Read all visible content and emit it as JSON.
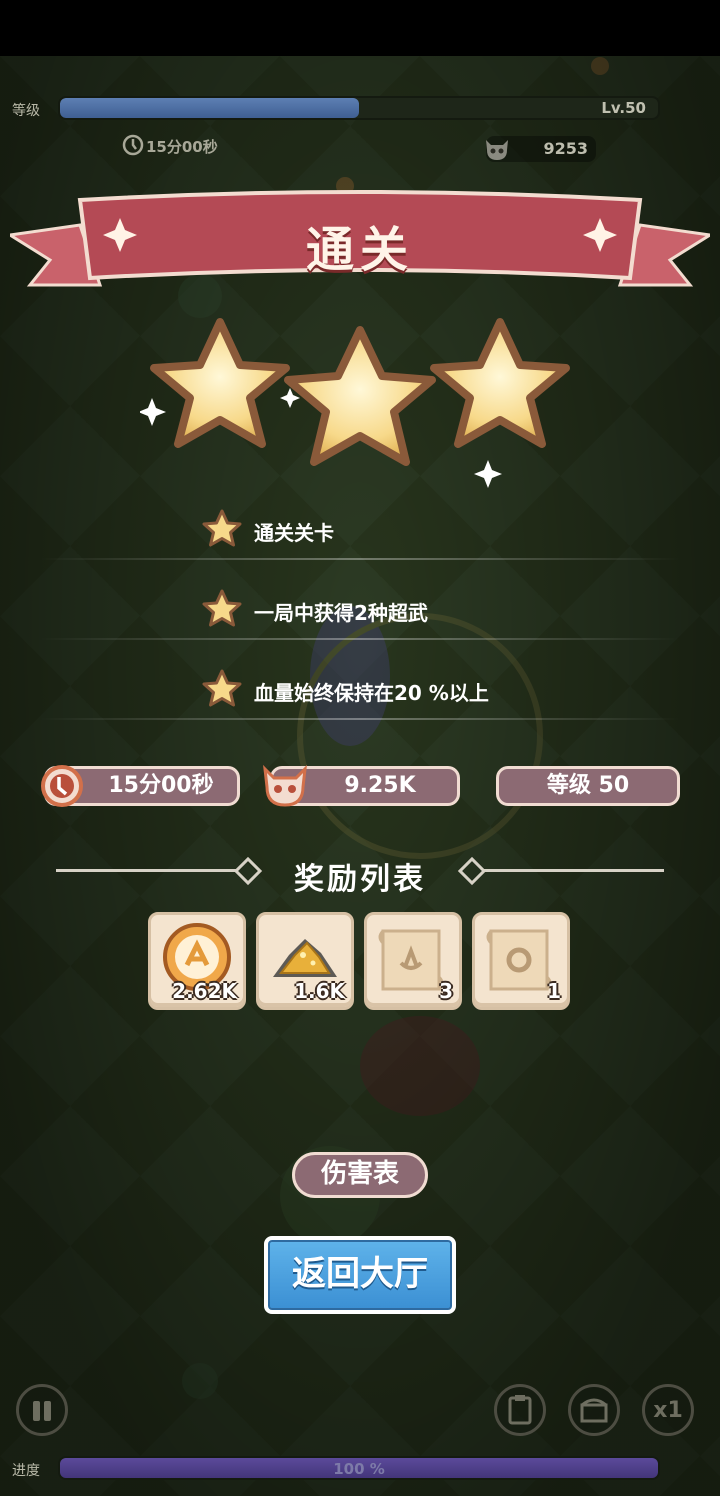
{
  "hud": {
    "level_label": "等级",
    "level_text": "Lv.50",
    "xp_progress": 0.5,
    "time": "15分00秒",
    "kills": "9253",
    "progress_label": "进度",
    "progress_text": "100 %",
    "progress": 1.0,
    "speed": "x1"
  },
  "result": {
    "title": "通关",
    "stars_earned": 3,
    "objectives": [
      {
        "text": "通关关卡"
      },
      {
        "text": "一局中获得2种超武"
      },
      {
        "text": "血量始终保持在20 %以上"
      }
    ],
    "stats": {
      "time": "15分00秒",
      "kills": "9.25K",
      "level": "等级 50"
    }
  },
  "rewards": {
    "title": "奖励列表",
    "items": [
      {
        "icon": "gold-coin-icon",
        "qty": "2.62K"
      },
      {
        "icon": "gold-ore-icon",
        "qty": "1.6K"
      },
      {
        "icon": "scroll-icon",
        "qty": "3"
      },
      {
        "icon": "scroll-icon",
        "qty": "1"
      }
    ]
  },
  "buttons": {
    "damage": "伤害表",
    "lobby": "返回大厅"
  },
  "colors": {
    "banner": "#b44a55",
    "pill": "#8c6a73",
    "lobby_button": "#4aa1e0",
    "star": "#f7d98a"
  }
}
